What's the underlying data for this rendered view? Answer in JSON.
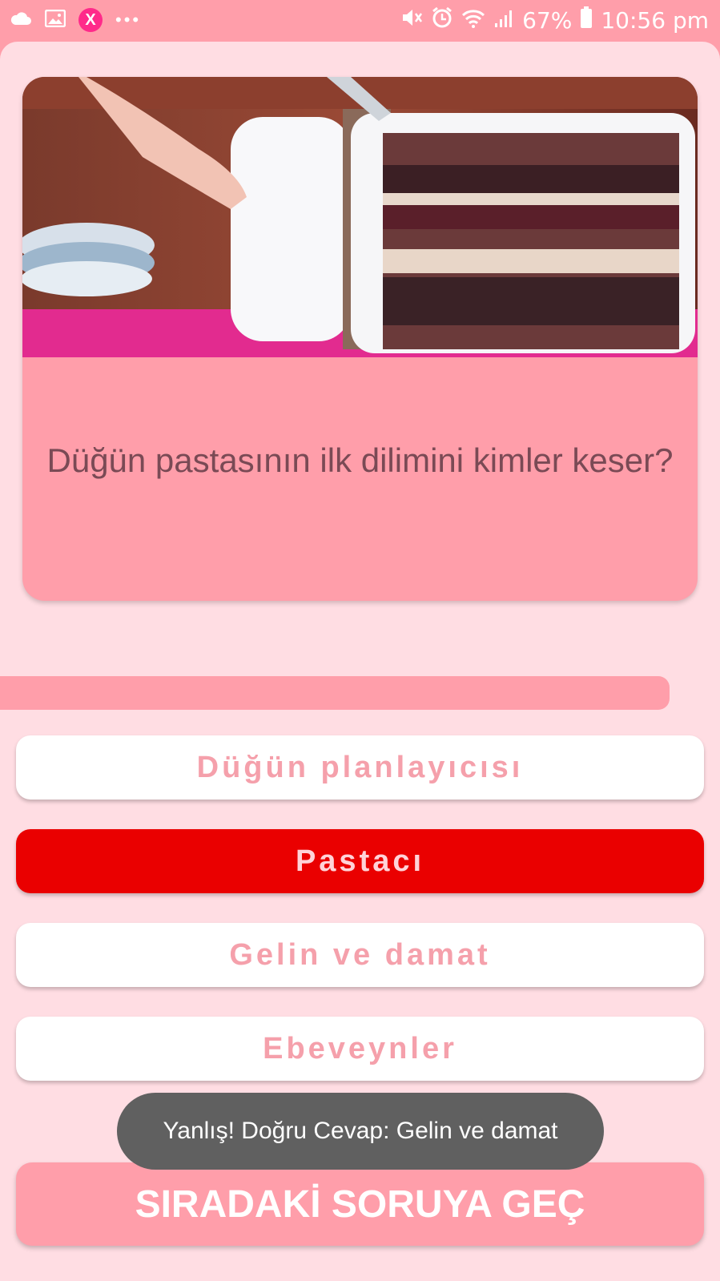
{
  "status_bar": {
    "battery": "67%",
    "time": "10:56 pm",
    "left_icons": [
      "cloud-icon",
      "gallery-icon",
      "app-notification-icon",
      "more-dots-icon"
    ],
    "right_icons": [
      "mute-icon",
      "alarm-icon",
      "wifi-icon",
      "signal-icon",
      "battery-icon"
    ]
  },
  "question": {
    "image": "wedding-cake-cutting-photo",
    "text": "Düğün pastasının ilk dilimini kimler keser?"
  },
  "options": [
    {
      "label": "Düğün planlayıcısı",
      "state": "default"
    },
    {
      "label": "Pastacı",
      "state": "selected-wrong"
    },
    {
      "label": "Gelin ve damat",
      "state": "default"
    },
    {
      "label": "Ebeveynler",
      "state": "default"
    }
  ],
  "progress": {
    "fraction": 0.93
  },
  "toast": {
    "text": "Yanlış! Doğru Cevap: Gelin ve damat"
  },
  "next_button": {
    "label": "SIRADAKİ SORUYA GEÇ"
  },
  "colors": {
    "accent": "#ff9eaa",
    "background": "#ffdde3",
    "wrong": "#ea0000",
    "option_text": "#f5a0ab",
    "question_text": "#7a4a55",
    "toast_bg": "#606060"
  }
}
